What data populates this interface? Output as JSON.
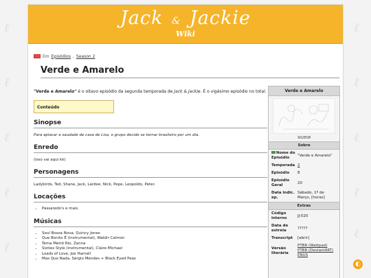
{
  "site": {
    "logo_part1": "Jack",
    "logo_amp": "&",
    "logo_part2": "Jackie",
    "logo_wiki": "Wiki"
  },
  "breadcrumb": {
    "prefix": "Em",
    "link1": "Episódios",
    "sep": ",",
    "link2": "Season 2"
  },
  "page": {
    "title": "Verde e Amarelo"
  },
  "intro": {
    "bold": "\"Verde e Amarelo\"",
    "text1": " é o oitavo episódio da segunda temporada de ",
    "show": "Jack & Jackie",
    "text2": ". É o vigésimo episódio no total."
  },
  "toc": {
    "label": "Conteúdo"
  },
  "sections": {
    "sinopse": {
      "title": "Sinopse",
      "text": "Para aplacar a saudade de casa de Lisa, o grupo decide se tornar brasileiro por um dia."
    },
    "enredo": {
      "title": "Enredo",
      "text": "(isso vai aqui kk)"
    },
    "personagens": {
      "title": "Personagens",
      "text": "Ladybirds, Ted, Shane, Jack, Lardee, Nick, Pepe, Leopoldo, Peter."
    },
    "locacoes": {
      "title": "Locações",
      "items": [
        "Passaredo's e mais."
      ]
    },
    "musicas": {
      "title": "Músicas",
      "items": [
        "Soul Bossa Nova, Quincy Jones",
        "Que Bonito É (instrumental), Waldir Calmon",
        "Tema Metrô Rio, Zanna",
        "Sixties Style (instrumental), Claire Michael",
        "Loads of Love, Joe Harnell",
        "Mas Que Nada, Sérgio Mendes + Black Eyed Peas"
      ]
    }
  },
  "infobox": {
    "title": "Verde e Amarelo",
    "caption": "S02E08",
    "section_about": "Sobre",
    "rows_about": [
      {
        "key": "Nome do Episódio",
        "value": "\"Verde e Amarelo\""
      },
      {
        "key": "Temporada",
        "value": "2"
      },
      {
        "key": "Episódio",
        "value": "8"
      },
      {
        "key": "Episódio Geral",
        "value": "20"
      },
      {
        "key": "Data indic. ep.",
        "value": "Sábado, 1º de Março, [horas]"
      }
    ],
    "section_extras": "Extras",
    "rows_extras": [
      {
        "key": "Código interno",
        "value": "JJ-020"
      },
      {
        "key": "Data de estreia",
        "value": "?????"
      },
      {
        "key": "Transcript",
        "value": "[abrir]"
      },
      {
        "key": "Versão literária",
        "value": "PTBR (Wattpad) PTBR (DeviantART) ENUS"
      }
    ]
  },
  "theme_toggle": {
    "icon": "half-moon-icon"
  }
}
